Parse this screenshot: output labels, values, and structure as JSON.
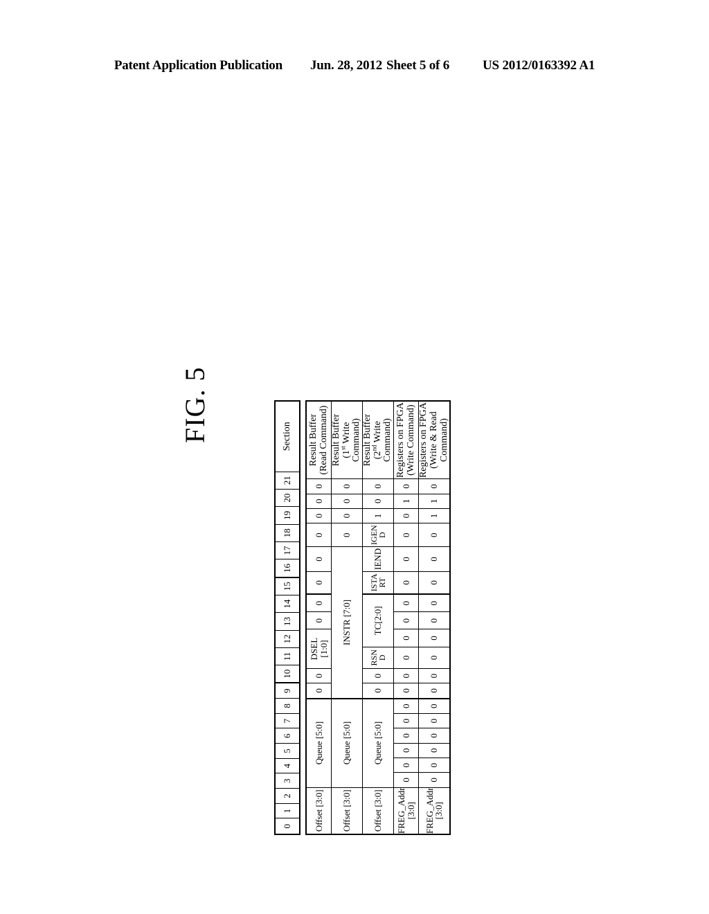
{
  "header": {
    "publication": "Patent Application Publication",
    "date": "Jun. 28, 2012",
    "sheet": "Sheet 5 of 6",
    "doc_number": "US 2012/0163392 A1"
  },
  "figure": {
    "label": "FIG. 5"
  },
  "table": {
    "section_header": "Section",
    "bit_numbers": [
      "0",
      "1",
      "2",
      "3",
      "4",
      "5",
      "6",
      "7",
      "8",
      "9",
      "10",
      "11",
      "12",
      "13",
      "14",
      "15",
      "16",
      "17",
      "18",
      "19",
      "20",
      "21"
    ],
    "rows": [
      {
        "label_line1": "Result Buffer",
        "label_line2": "(Read Command)",
        "cells": [
          {
            "text": "Offset [3:0]",
            "span": 4
          },
          {
            "text": "Queue [5:0]",
            "span": 6
          },
          {
            "text": "0",
            "span": 1
          },
          {
            "text": "0",
            "span": 1
          },
          {
            "text": "DSEL [1:0]",
            "span": 2
          },
          {
            "text": "0",
            "span": 1
          },
          {
            "text": "0",
            "span": 1
          },
          {
            "text": "0",
            "span": 1
          },
          {
            "text": "0",
            "span": 1
          },
          {
            "text": "0",
            "span": 1
          },
          {
            "text": "0",
            "span": 1
          },
          {
            "text": "0",
            "span": 1
          },
          {
            "text": "0",
            "span": 1
          }
        ]
      },
      {
        "label_line1": "Result Buffer",
        "label_line2": "(1st  Write Command)",
        "label_sup": "st",
        "cells": [
          {
            "text": "Offset [3:0]",
            "span": 4
          },
          {
            "text": "Queue [5:0]",
            "span": 6
          },
          {
            "text": "INSTR [7:0]",
            "span": 8
          },
          {
            "text": "0",
            "span": 1
          },
          {
            "text": "0",
            "span": 1
          },
          {
            "text": "0",
            "span": 1
          },
          {
            "text": "0",
            "span": 1
          }
        ]
      },
      {
        "label_line1": "Result Buffer",
        "label_line2": "(2nd Write Command)",
        "label_sup": "nd",
        "cells": [
          {
            "text": "Offset [3:0]",
            "span": 4
          },
          {
            "text": "Queue [5:0]",
            "span": 6
          },
          {
            "text": "0",
            "span": 1
          },
          {
            "text": "0",
            "span": 1
          },
          {
            "text": "RSN D",
            "span": 1,
            "twoline": [
              "RSN",
              "D"
            ]
          },
          {
            "text": "TC[2:0]",
            "span": 3
          },
          {
            "text": "ISTA RT",
            "span": 1,
            "twoline": [
              "ISTA",
              "RT"
            ]
          },
          {
            "text": "IEND",
            "span": 1
          },
          {
            "text": "IGEN D",
            "span": 1,
            "twoline": [
              "IGEN",
              "D"
            ]
          },
          {
            "text": "1",
            "span": 1
          },
          {
            "text": "0",
            "span": 1
          },
          {
            "text": "0",
            "span": 1
          }
        ]
      },
      {
        "label_line1": "Registers on FPGA",
        "label_line2": "(Write Command)",
        "cells": [
          {
            "text": "FREG_Addr [3:0]",
            "span": 4
          },
          {
            "text": "0",
            "span": 1
          },
          {
            "text": "0",
            "span": 1
          },
          {
            "text": "0",
            "span": 1
          },
          {
            "text": "0",
            "span": 1
          },
          {
            "text": "0",
            "span": 1
          },
          {
            "text": "0",
            "span": 1
          },
          {
            "text": "0",
            "span": 1
          },
          {
            "text": "0",
            "span": 1
          },
          {
            "text": "0",
            "span": 1
          },
          {
            "text": "0",
            "span": 1
          },
          {
            "text": "0",
            "span": 1
          },
          {
            "text": "0",
            "span": 1
          },
          {
            "text": "0",
            "span": 1
          },
          {
            "text": "0",
            "span": 1
          },
          {
            "text": "0",
            "span": 1
          },
          {
            "text": "0",
            "span": 1
          },
          {
            "text": "1",
            "span": 1
          },
          {
            "text": "0",
            "span": 1
          }
        ]
      },
      {
        "label_line1": "Registers on FPGA",
        "label_line2": "(Write & Read Command)",
        "cells": [
          {
            "text": "FREG_Addr [3:0]",
            "span": 4
          },
          {
            "text": "0",
            "span": 1
          },
          {
            "text": "0",
            "span": 1
          },
          {
            "text": "0",
            "span": 1
          },
          {
            "text": "0",
            "span": 1
          },
          {
            "text": "0",
            "span": 1
          },
          {
            "text": "0",
            "span": 1
          },
          {
            "text": "0",
            "span": 1
          },
          {
            "text": "0",
            "span": 1
          },
          {
            "text": "0",
            "span": 1
          },
          {
            "text": "0",
            "span": 1
          },
          {
            "text": "0",
            "span": 1
          },
          {
            "text": "0",
            "span": 1
          },
          {
            "text": "0",
            "span": 1
          },
          {
            "text": "0",
            "span": 1
          },
          {
            "text": "0",
            "span": 1
          },
          {
            "text": "1",
            "span": 1
          },
          {
            "text": "1",
            "span": 1
          },
          {
            "text": "0",
            "span": 1
          }
        ]
      }
    ]
  }
}
